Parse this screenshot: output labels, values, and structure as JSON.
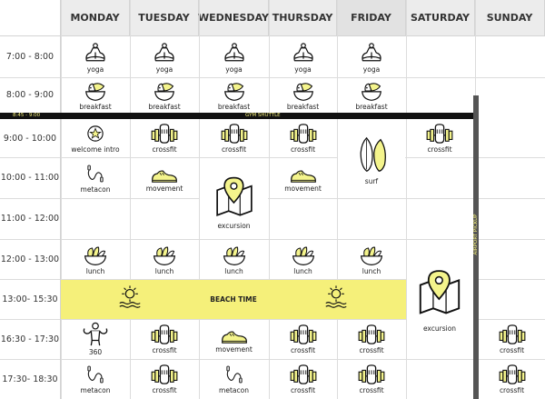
{
  "days": [
    "MONDAY",
    "TUESDAY",
    "WEDNESDAY",
    "THURSDAY",
    "FRIDAY",
    "SATURDAY",
    "SUNDAY"
  ],
  "times": [
    "7:00 - 8:00",
    "8:00 - 9:00",
    "9:00 - 10:00",
    "10:00 - 11:00",
    "11:00 - 12:00",
    "12:00 - 13:00",
    "13:00- 15:30",
    "16:30 - 17:30",
    "17:30- 18:30"
  ],
  "gym_shuttle": {
    "time": "8:45 - 9:00",
    "label": "GYM SHUTTLE"
  },
  "airport_pickup": {
    "label": "AIRPORT PICKUP"
  },
  "beach_time": {
    "label": "BEACH TIME"
  },
  "activities": {
    "yoga": "yoga",
    "breakfast": "breakfast",
    "welcome_intro": "welcome intro",
    "crossfit": "crossfit",
    "surf": "surf",
    "metacon": "metacon",
    "movement": "movement",
    "excursion": "excursion",
    "lunch": "lunch",
    "three_sixty": "360"
  },
  "colors": {
    "accent_yellow": "#f5f07a",
    "icon_fill_yellow": "#f4f48c",
    "header_grey": "#ececec",
    "header_friday": "#e2e2e2",
    "bar_black": "#111111",
    "pickup_grey": "#555555"
  }
}
